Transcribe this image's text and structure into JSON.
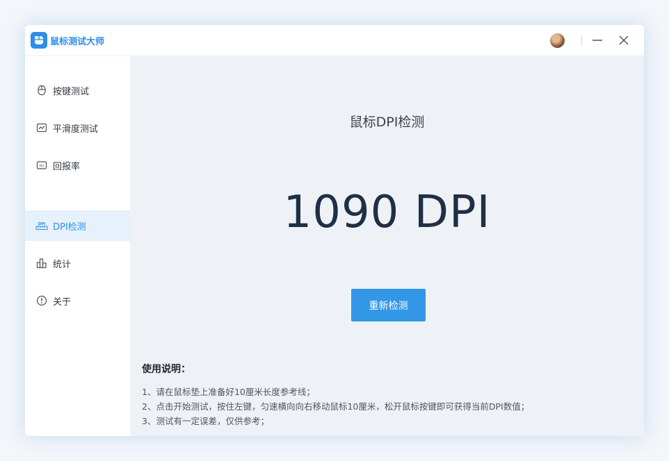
{
  "app": {
    "title": "鼠标测试大师",
    "logo_icon": "mouse-logo-icon",
    "accent_color": "#2f8ee6"
  },
  "titlebar": {
    "avatar_icon": "user-avatar",
    "minimize_icon": "minimize-icon",
    "close_icon": "close-icon"
  },
  "sidebar": {
    "items": [
      {
        "label": "按键测试",
        "icon": "mouse-icon",
        "active": false
      },
      {
        "label": "平滑度测试",
        "icon": "line-chart-icon",
        "active": false
      },
      {
        "label": "回报率",
        "icon": "hz-icon",
        "active": false
      },
      {
        "label": "DPI检测",
        "icon": "dpi-ruler-icon",
        "active": true
      },
      {
        "label": "统计",
        "icon": "bar-chart-icon",
        "active": false
      },
      {
        "label": "关于",
        "icon": "info-icon",
        "active": false
      }
    ]
  },
  "main": {
    "title": "鼠标DPI检测",
    "dpi_value": "1090 DPI",
    "recheck_label": "重新检测",
    "instructions": {
      "heading": "使用说明：",
      "lines": [
        "1、请在鼠标垫上准备好10厘米长度参考线；",
        "2、点击开始测试，按住左键，匀速横向向右移动鼠标10厘米，松开鼠标按键即可获得当前DPI数值；",
        "3、测试有一定误差，仅供参考；"
      ]
    }
  }
}
